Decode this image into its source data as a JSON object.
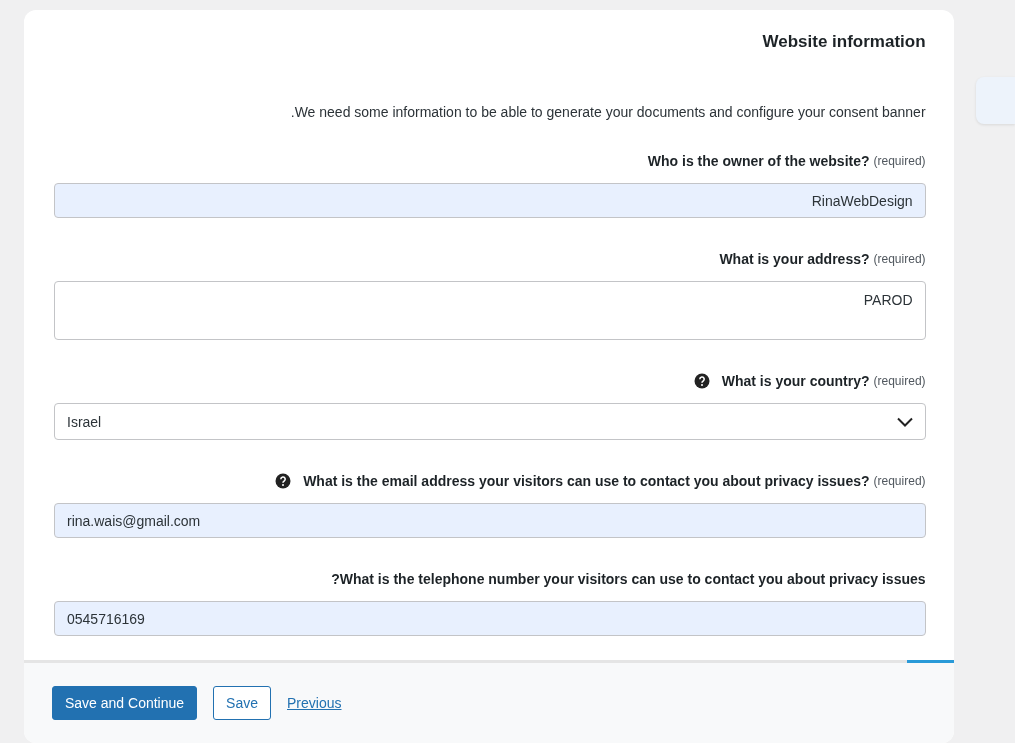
{
  "title": "Website information",
  "description": ".We need some information to be able to generate your documents and configure your consent banner",
  "fields": [
    {
      "kind": "text",
      "label": "Who is the owner of the website?",
      "required_note": "(required)",
      "help": false,
      "autofilled": true,
      "value": "RinaWebDesign"
    },
    {
      "kind": "textarea",
      "label": "What is your address?",
      "required_note": "(required)",
      "help": false,
      "autofilled": false,
      "value": "PAROD"
    },
    {
      "kind": "select",
      "label": "What is your country?",
      "required_note": "(required)",
      "help": true,
      "autofilled": false,
      "value": "Israel"
    },
    {
      "kind": "email",
      "label": "What is the email address your visitors can use to contact you about privacy issues?",
      "required_note": "(required)",
      "help": true,
      "autofilled": true,
      "value": "rina.wais@gmail.com"
    },
    {
      "kind": "tel",
      "label": "?What is the telephone number your visitors can use to contact you about privacy issues",
      "help": false,
      "autofilled": true,
      "value": "0545716169"
    }
  ],
  "progress": {
    "level": 0.05
  },
  "buttons": [
    {
      "kind": "primary",
      "label": "Save and Continue"
    },
    {
      "kind": "outline",
      "label": "Save"
    },
    {
      "kind": "link",
      "label": "Previous"
    }
  ]
}
